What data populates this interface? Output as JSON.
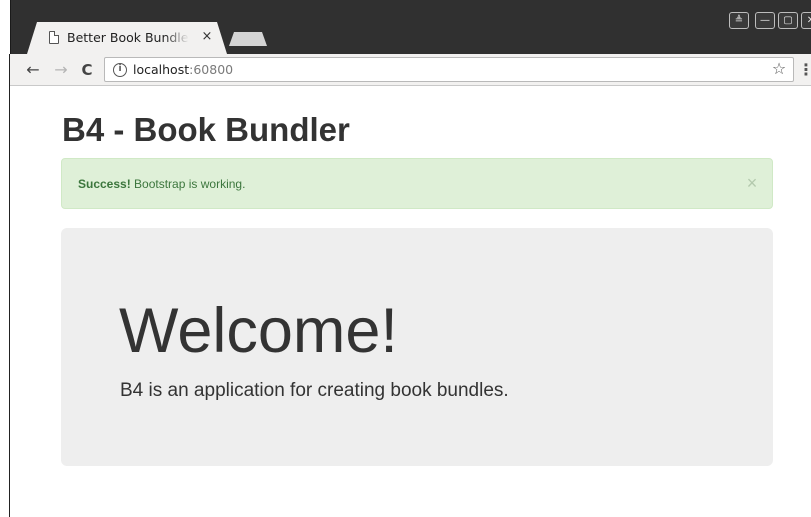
{
  "browser": {
    "tab": {
      "title": "Better Book Bundler",
      "close_glyph": "×"
    },
    "window_buttons": [
      {
        "name": "user",
        "glyph": "≜"
      },
      {
        "name": "minimize",
        "glyph": "—"
      },
      {
        "name": "maximize",
        "glyph": "▢"
      },
      {
        "name": "close",
        "glyph": "✕"
      }
    ],
    "nav": {
      "back_glyph": "←",
      "forward_glyph": "→",
      "reload_glyph": "C"
    },
    "omnibox": {
      "info_glyph": "i",
      "url_host": "localhost",
      "url_port": ":60800",
      "star_glyph": "☆"
    },
    "menu_glyph": "⋮"
  },
  "page": {
    "title": "B4 - Book Bundler",
    "alert": {
      "strong": "Success!",
      "text": " Bootstrap is working.",
      "close_glyph": "×",
      "color": "#3c763d",
      "background": "#dff0d8"
    },
    "jumbotron": {
      "heading": "Welcome!",
      "lead": "B4 is an application for creating book bundles."
    }
  },
  "icons": {
    "tab_icon": "document-icon",
    "info_icon": "info-icon",
    "star_icon": "star-icon",
    "menu_icon": "kebab-menu-icon"
  }
}
